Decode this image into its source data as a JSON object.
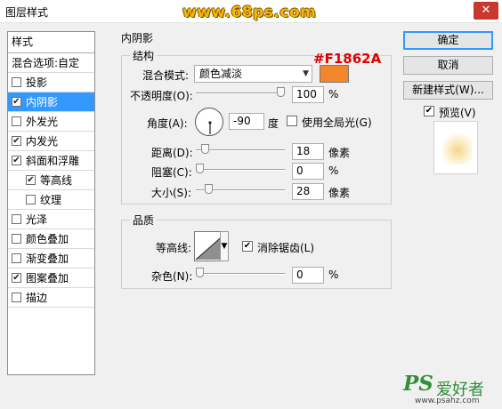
{
  "window": {
    "title": "图层样式",
    "close_label": "✕"
  },
  "watermark_top": "www.68ps.com",
  "style_list": {
    "header": "样式",
    "blend_options": "混合选项:自定",
    "items": [
      {
        "label": "投影",
        "checked": false,
        "indent": false,
        "active": false
      },
      {
        "label": "内阴影",
        "checked": true,
        "indent": false,
        "active": true
      },
      {
        "label": "外发光",
        "checked": false,
        "indent": false,
        "active": false
      },
      {
        "label": "内发光",
        "checked": true,
        "indent": false,
        "active": false
      },
      {
        "label": "斜面和浮雕",
        "checked": true,
        "indent": false,
        "active": false
      },
      {
        "label": "等高线",
        "checked": true,
        "indent": true,
        "active": false
      },
      {
        "label": "纹理",
        "checked": false,
        "indent": true,
        "active": false
      },
      {
        "label": "光泽",
        "checked": false,
        "indent": false,
        "active": false
      },
      {
        "label": "颜色叠加",
        "checked": false,
        "indent": false,
        "active": false
      },
      {
        "label": "渐变叠加",
        "checked": false,
        "indent": false,
        "active": false
      },
      {
        "label": "图案叠加",
        "checked": true,
        "indent": false,
        "active": false
      },
      {
        "label": "描边",
        "checked": false,
        "indent": false,
        "active": false
      }
    ]
  },
  "panel": {
    "title": "内阴影",
    "structure": {
      "legend": "结构",
      "blend_mode_label": "混合模式:",
      "blend_mode_value": "颜色减淡",
      "color": "#F1862A",
      "color_annotation": "#F1862A",
      "opacity_label": "不透明度(O):",
      "opacity_value": "100",
      "opacity_fraction": 1.0,
      "angle_label": "角度(A):",
      "angle_value": "-90",
      "angle_unit": "度",
      "global_light_label": "使用全局光(G)",
      "global_light_checked": false,
      "distance_label": "距离(D):",
      "distance_value": "18",
      "distance_fraction": 0.07,
      "choke_label": "阻塞(C):",
      "choke_value": "0",
      "choke_fraction": 0.0,
      "size_label": "大小(S):",
      "size_value": "28",
      "size_fraction": 0.11,
      "unit_px": "像素",
      "unit_percent": "%"
    },
    "quality": {
      "legend": "品质",
      "contour_label": "等高线:",
      "anti_alias_label": "消除锯齿(L)",
      "anti_alias_checked": true,
      "noise_label": "杂色(N):",
      "noise_value": "0",
      "noise_fraction": 0.0,
      "unit_percent": "%"
    }
  },
  "buttons": {
    "ok": "确定",
    "cancel": "取消",
    "new_style": "新建样式(W)...",
    "preview_label": "预览(V)",
    "preview_checked": true
  },
  "watermark_bottom": {
    "logo": "PS",
    "cn": "爱好者",
    "site": "www.psahz.com"
  }
}
